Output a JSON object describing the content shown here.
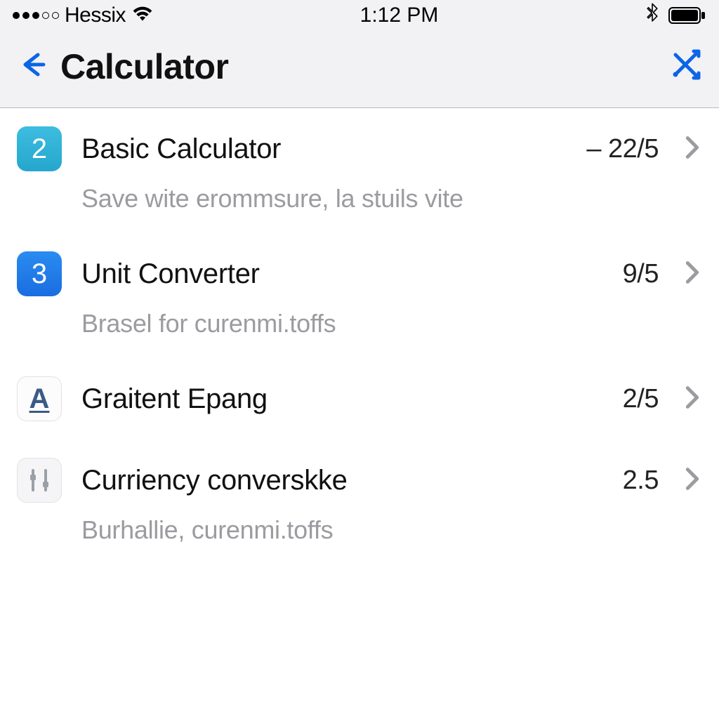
{
  "status": {
    "carrier": "Hessix",
    "time": "1:12 PM"
  },
  "nav": {
    "title": "Calculator"
  },
  "items": [
    {
      "icon_char": "2",
      "title": "Basic Calculator",
      "value": "– 22/5",
      "subtitle": "Save wite erommsure, la stuils vite"
    },
    {
      "icon_char": "3",
      "title": "Unit Converter",
      "value": "9/5",
      "subtitle": "Brasel for curenmi.toffs"
    },
    {
      "icon_char": "A",
      "title": "Graitent Epang",
      "value": "2/5",
      "subtitle": ""
    },
    {
      "icon_char": "",
      "title": "Curriency converskke",
      "value": "2.5",
      "subtitle": "Burhallie, curenmi.toffs"
    }
  ]
}
